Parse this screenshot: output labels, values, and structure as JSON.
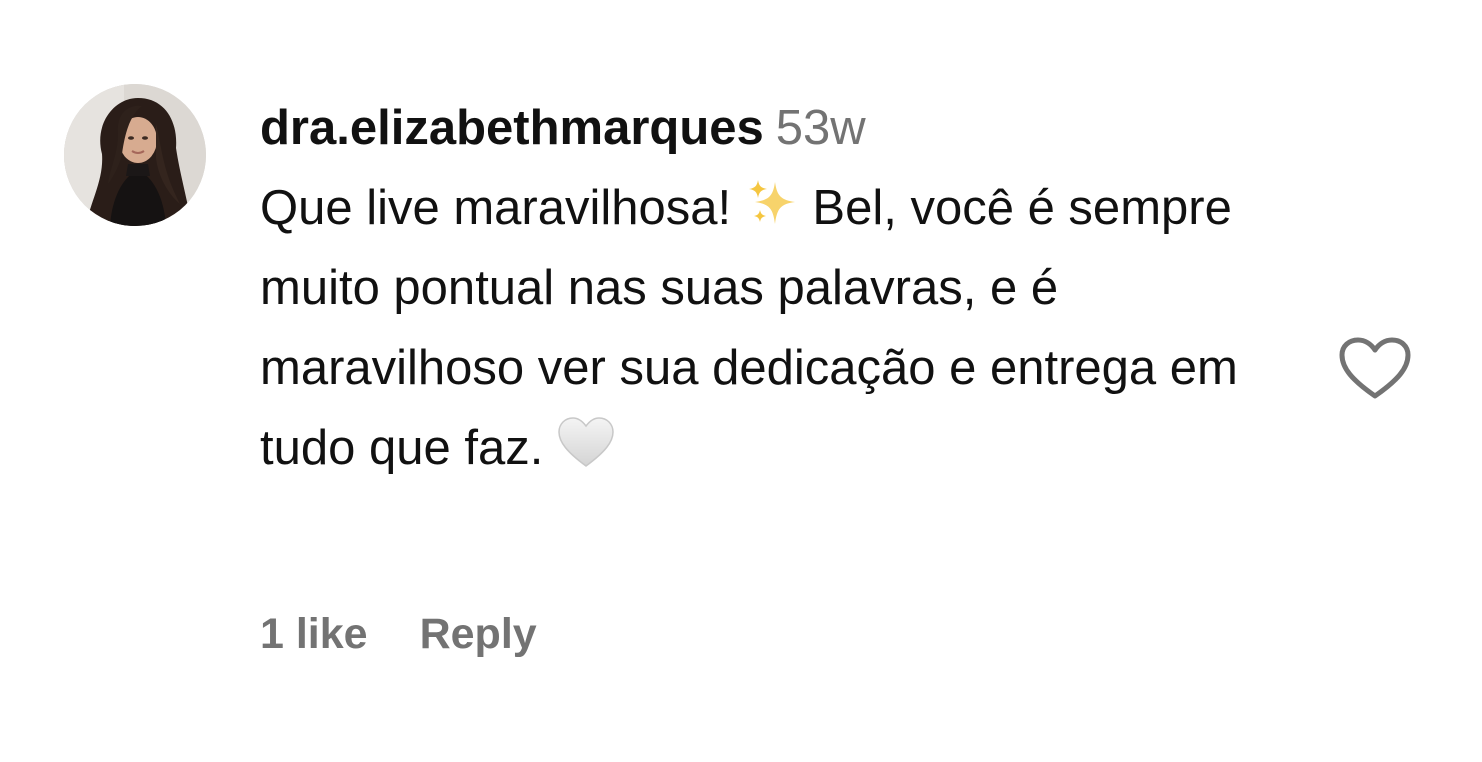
{
  "comment": {
    "username": "dra.elizabethmarques",
    "timestamp": "53w",
    "text_part1": "Que live maravilhosa!",
    "emoji_1": "sparkles-emoji",
    "text_part2": "Bel, você é sempre muito pontual nas suas palavras, e é maravilhoso ver sua dedicação e entrega em tudo que faz.",
    "emoji_2": "white-heart-emoji",
    "likes_label": "1 like",
    "reply_label": "Reply",
    "like_icon": "heart-outline-icon"
  },
  "colors": {
    "primary_text": "#111111",
    "secondary_text": "#737373",
    "sparkle": "#F5C640",
    "icon_outline": "#737373"
  }
}
